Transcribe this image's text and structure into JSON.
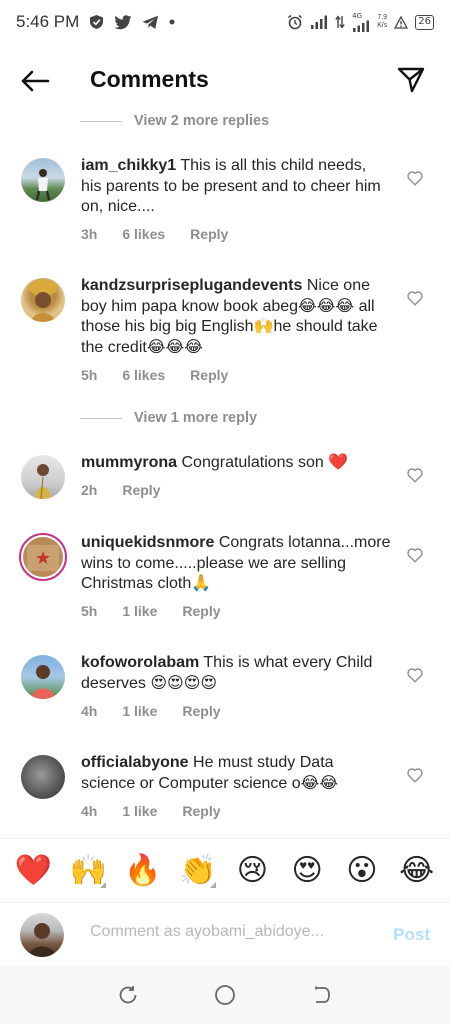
{
  "status_bar": {
    "time": "5:46 PM",
    "network_type": "4G",
    "speed_value": "7.9",
    "speed_unit": "K/s",
    "battery": "26"
  },
  "header": {
    "title": "Comments"
  },
  "view_more": [
    {
      "label": "View 2 more replies"
    },
    {
      "label": "View 1 more reply"
    }
  ],
  "comments": [
    {
      "username": "iam_chikky1",
      "text": "This is all this child needs, his parents to be present and to cheer him on, nice....",
      "time": "3h",
      "likes": "6 likes",
      "reply": "Reply"
    },
    {
      "username": "kandzsurpriseplugandevents",
      "text": "Nice one boy him papa know book abeg😂😂😂 all those his big big English🙌he should take the credit😂😂😂",
      "time": "5h",
      "likes": "6 likes",
      "reply": "Reply"
    },
    {
      "username": "mummyrona",
      "text": "Congratulations son ❤️",
      "time": "2h",
      "likes": "",
      "reply": "Reply"
    },
    {
      "username": "uniquekidsnmore",
      "text": "Congrats lotanna...more wins to come.....please we are selling Christmas cloth🙏",
      "time": "5h",
      "likes": "1 like",
      "reply": "Reply"
    },
    {
      "username": "kofoworolabam",
      "text": "This is what every Child deserves 😍😍😍😍",
      "time": "4h",
      "likes": "1 like",
      "reply": "Reply"
    },
    {
      "username": "officialabyone",
      "text": "He must study Data science or Computer science o😂😂",
      "time": "4h",
      "likes": "1 like",
      "reply": "Reply"
    }
  ],
  "reactions": [
    "❤️",
    "🙌",
    "🔥",
    "👏",
    "😢",
    "😍",
    "😮",
    "😂"
  ],
  "input": {
    "placeholder": "Comment as ayobami_abidoye...",
    "post_label": "Post"
  },
  "colors": {
    "text": "#262626",
    "secondary": "#8e8e8e",
    "post_disabled": "#b2dffc",
    "heart": "#e0245e"
  },
  "icons": [
    "back-arrow-icon",
    "send-icon",
    "heart-outline-icon",
    "recents-icon",
    "home-icon",
    "back-nav-icon"
  ]
}
